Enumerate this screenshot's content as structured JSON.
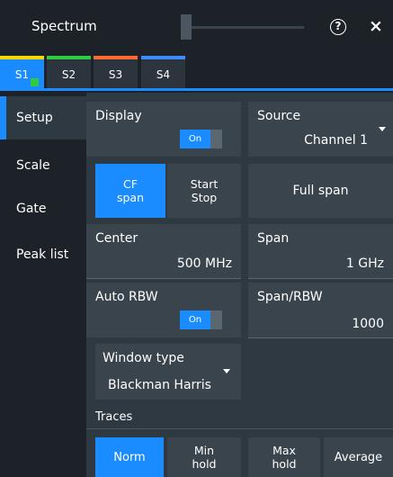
{
  "header": {
    "title": "Spectrum",
    "help_icon": "?",
    "close_icon": "×"
  },
  "tabs": [
    {
      "label": "S1",
      "color": "#f5d800",
      "active": true
    },
    {
      "label": "S2",
      "color": "#2ecc40",
      "active": false
    },
    {
      "label": "S3",
      "color": "#ff6a30",
      "active": false
    },
    {
      "label": "S4",
      "color": "#3c8cff",
      "active": false
    }
  ],
  "sidenav": {
    "items": [
      {
        "label": "Setup",
        "active": true
      },
      {
        "label": "Scale",
        "active": false
      },
      {
        "label": "Gate",
        "active": false
      },
      {
        "label": "Peak list",
        "active": false
      }
    ]
  },
  "display": {
    "label": "Display",
    "toggle": "On"
  },
  "source": {
    "label": "Source",
    "value": "Channel 1"
  },
  "span_mode": {
    "cf_span": "CF\nspan",
    "start_stop": "Start\nStop",
    "full_span": "Full span"
  },
  "center": {
    "label": "Center",
    "value": "500 MHz"
  },
  "span": {
    "label": "Span",
    "value": "1 GHz"
  },
  "auto_rbw": {
    "label": "Auto RBW",
    "toggle": "On"
  },
  "span_rbw": {
    "label": "Span/RBW",
    "value": "1000"
  },
  "window_type": {
    "label": "Window type",
    "value": "Blackman Harris"
  },
  "traces": {
    "label": "Traces",
    "buttons": [
      {
        "label": "Norm",
        "active": true
      },
      {
        "label": "Min\nhold",
        "active": false
      },
      {
        "label": "Max\nhold",
        "active": false
      },
      {
        "label": "Average",
        "active": false
      }
    ]
  },
  "colors": {
    "accent": "#1a8cff",
    "panel": "#3a444c",
    "background": "#1c2227"
  }
}
